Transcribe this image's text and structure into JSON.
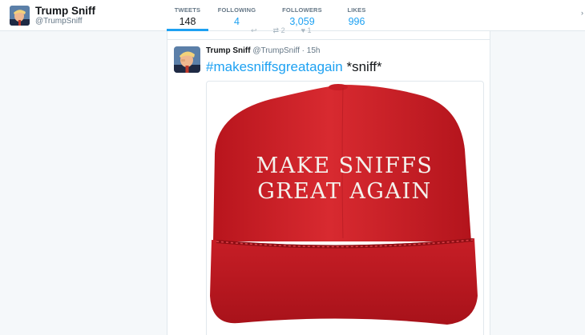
{
  "profile": {
    "name": "Trump Sniff",
    "handle": "@TrumpSniff",
    "avatar_icon": "profile-photo"
  },
  "stats": [
    {
      "label": "TWEETS",
      "value": "148",
      "active": true
    },
    {
      "label": "FOLLOWING",
      "value": "4",
      "active": false
    },
    {
      "label": "FOLLOWERS",
      "value": "3,059",
      "active": false
    },
    {
      "label": "LIKES",
      "value": "996",
      "active": false
    }
  ],
  "prev_tweet": {
    "actions": [
      "↩",
      "⇄ 2",
      "♥ 1"
    ]
  },
  "tweet": {
    "name": "Trump Sniff",
    "handle": "@TrumpSniff",
    "separator": "·",
    "time": "15h",
    "hashtag": "#makesniffsgreatagain",
    "text": " *sniff*",
    "media": {
      "hat_line1": "MAKE SNIFFS",
      "hat_line2": "GREAT AGAIN",
      "hat_color": "#d01f28",
      "text_color": "#f4f1ec"
    }
  },
  "colors": {
    "accent": "#1da1f2",
    "background": "#f5f8fa",
    "border": "#e1e8ed"
  }
}
